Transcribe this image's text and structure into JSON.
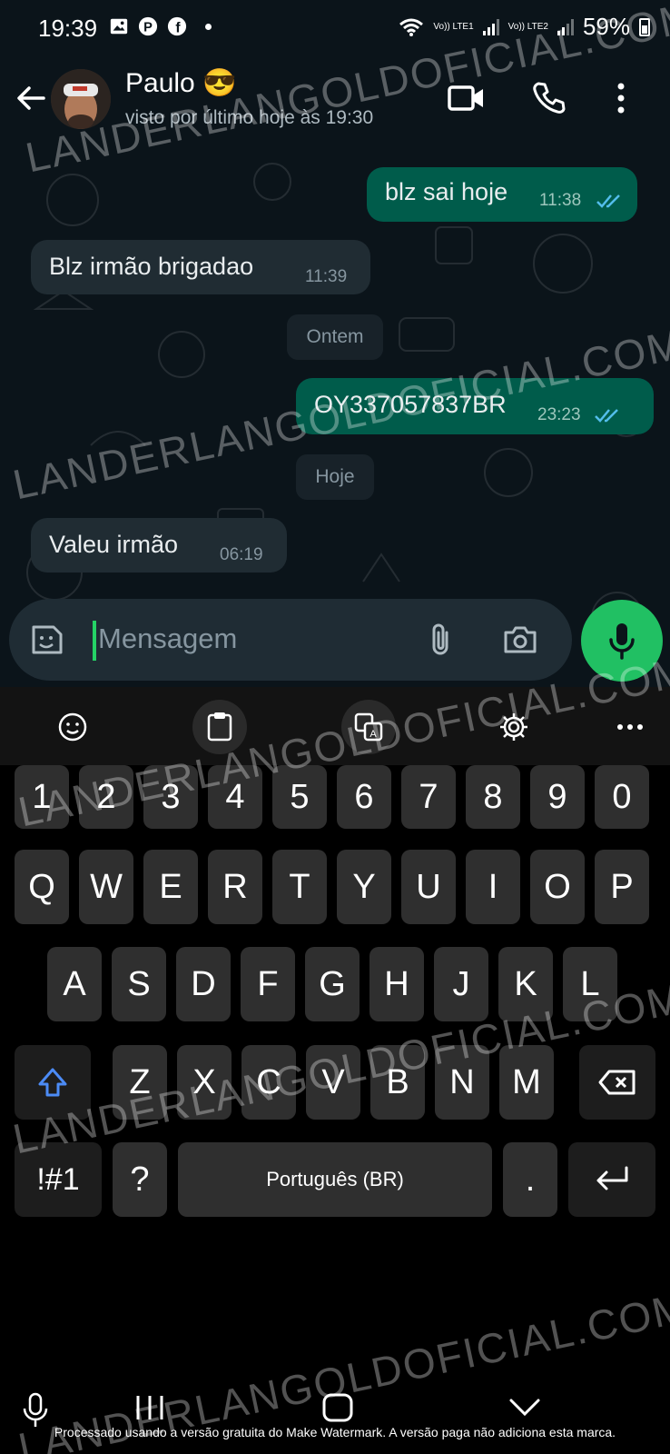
{
  "status_bar": {
    "time": "19:39",
    "net1": "Vo)) LTE1",
    "net2": "Vo)) LTE2",
    "battery": "59%"
  },
  "header": {
    "contact_name": "Paulo 😎",
    "last_seen": "visto por último hoje às 19:30"
  },
  "messages": [
    {
      "direction": "out",
      "text": "blz sai hoje",
      "time": "11:38",
      "read": true
    },
    {
      "direction": "in",
      "text": "Blz irmão brigadao",
      "time": "11:39"
    },
    {
      "direction": "day",
      "text": "Ontem"
    },
    {
      "direction": "out",
      "text": "OY337057837BR",
      "time": "23:23",
      "read": true
    },
    {
      "direction": "day",
      "text": "Hoje"
    },
    {
      "direction": "in",
      "text": "Valeu irmão",
      "time": "06:19"
    }
  ],
  "composer": {
    "placeholder": "Mensagem"
  },
  "keyboard": {
    "numbers": [
      "1",
      "2",
      "3",
      "4",
      "5",
      "6",
      "7",
      "8",
      "9",
      "0"
    ],
    "row1": [
      "Q",
      "W",
      "E",
      "R",
      "T",
      "Y",
      "U",
      "I",
      "O",
      "P"
    ],
    "row2": [
      "A",
      "S",
      "D",
      "F",
      "G",
      "H",
      "J",
      "K",
      "L"
    ],
    "row3": [
      "Z",
      "X",
      "C",
      "V",
      "B",
      "N",
      "M"
    ],
    "symbols_key": "!#1",
    "question_key": "?",
    "space_label": "Português (BR)",
    "period_key": "."
  },
  "watermark": {
    "text": "LANDERLANGOLDOFICIAL.COM.BR",
    "footer": "Processado usando a versão gratuita do Make Watermark. A versão paga não adiciona esta marca."
  },
  "colors": {
    "outgoing_bubble": "#005c4b",
    "incoming_bubble": "#202c33",
    "accent_green": "#21c063",
    "read_ticks": "#53bdeb"
  }
}
